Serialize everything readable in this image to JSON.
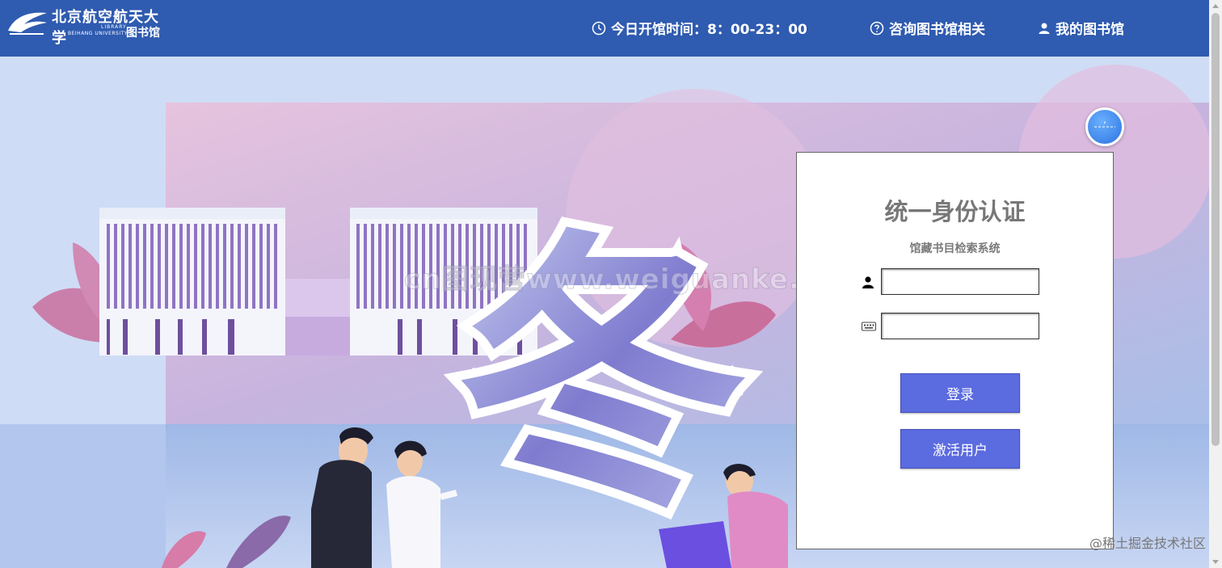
{
  "header": {
    "logo_cn": "北京航空航天大学",
    "logo_en_line1": "LIBRARY",
    "logo_en_line2": "BEIHANG UNIVERSITY",
    "logo_cn2": "图书馆",
    "hours": "今日开馆时间：8：00-23：00",
    "consult": "咨询图书馆相关",
    "my_library": "我的图书馆"
  },
  "login": {
    "title": "统一身份认证",
    "subtitle": "馆藏书目检索系统",
    "username_value": "",
    "password_value": "",
    "login_label": "登录",
    "activate_label": "激活用户"
  },
  "hero": {
    "character": "冬"
  },
  "watermark": "cn图现营www.weiguanke.cn",
  "corner_mark": "@稀土掘金技术社区",
  "colors": {
    "header_bg": "#2f5bb0",
    "button_bg": "#5b6be0",
    "page_bg": "#cfdcf5"
  },
  "icons": {
    "hours": "clock-icon",
    "consult": "question-circle-icon",
    "my_library": "user-icon",
    "username": "user-icon",
    "password": "keyboard-icon"
  }
}
